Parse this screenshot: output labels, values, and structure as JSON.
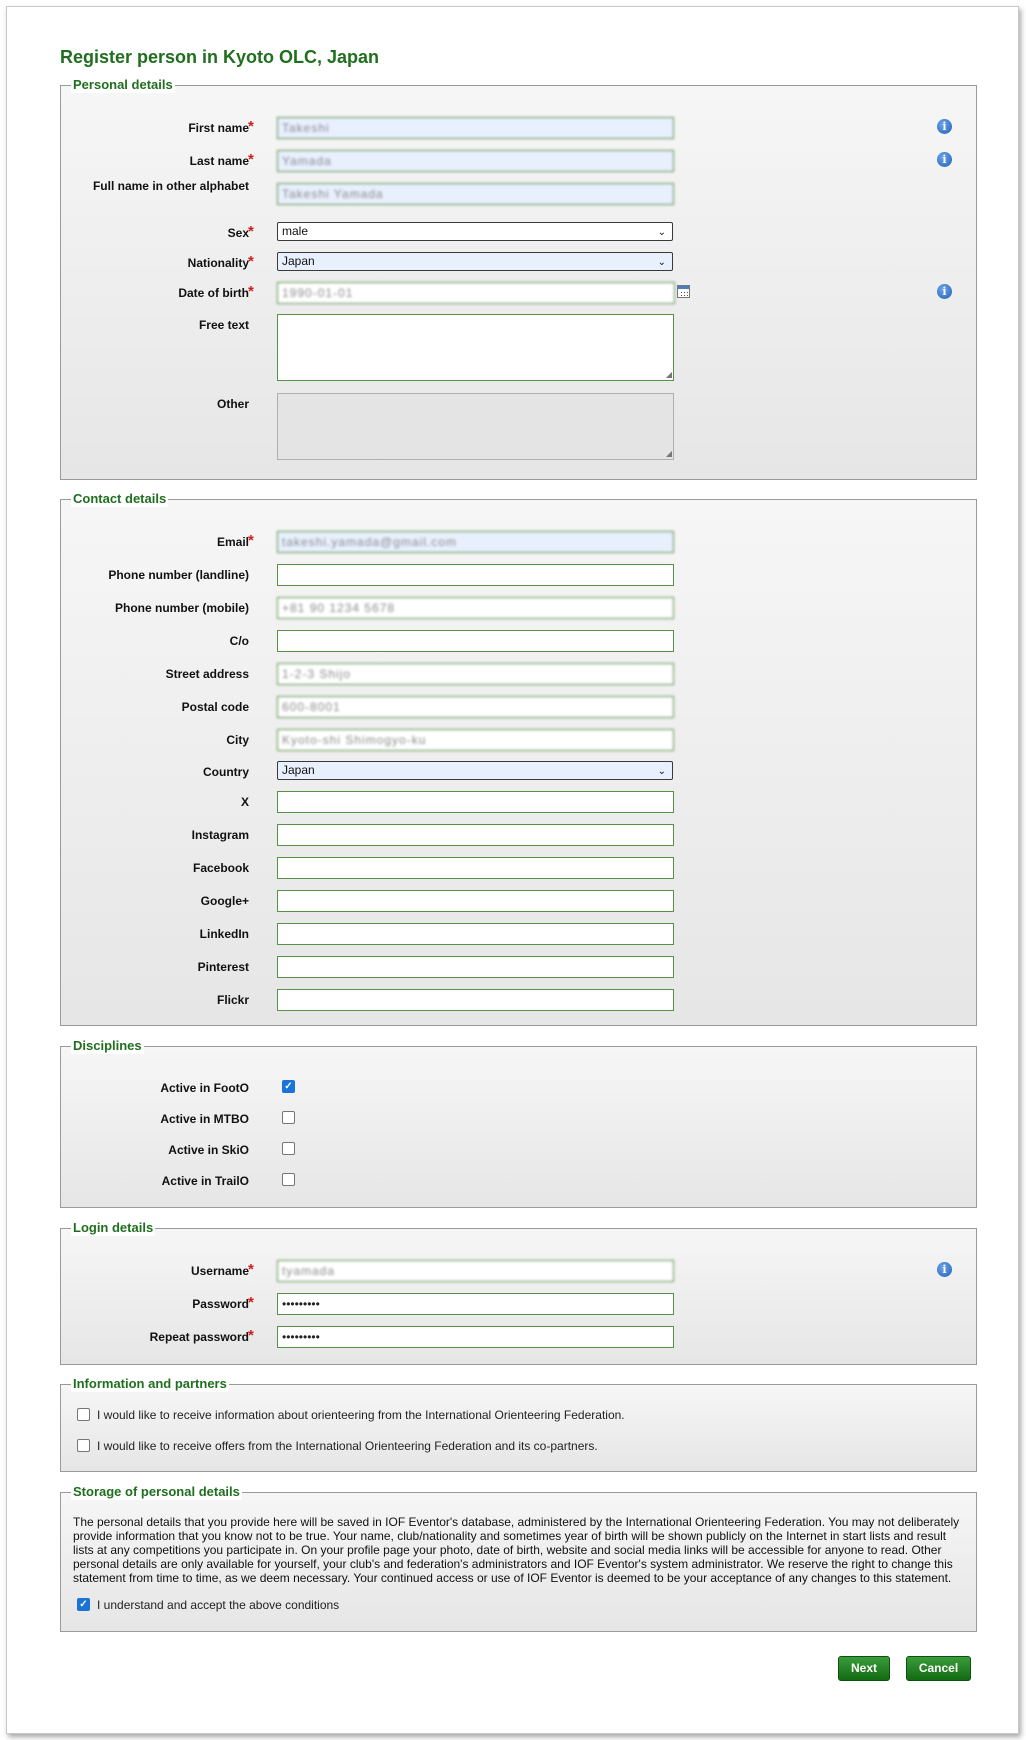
{
  "page_title": "Register person in Kyoto OLC, Japan",
  "personal": {
    "legend": "Personal details",
    "first_name_label": "First name",
    "first_name_value": "Takeshi",
    "last_name_label": "Last name",
    "last_name_value": "Yamada",
    "full_name_label": "Full name in other alphabet",
    "full_name_value": "Takeshi Yamada",
    "sex_label": "Sex",
    "sex_value": "male",
    "nationality_label": "Nationality",
    "nationality_value": "Japan",
    "dob_label": "Date of birth",
    "dob_value": "1990-01-01",
    "free_text_label": "Free text",
    "other_label": "Other"
  },
  "contact": {
    "legend": "Contact details",
    "email_label": "Email",
    "email_value": "takeshi.yamada@gmail.com",
    "phone_landline_label": "Phone number (landline)",
    "phone_mobile_label": "Phone number (mobile)",
    "phone_mobile_value": "+81 90 1234 5678",
    "co_label": "C/o",
    "street_label": "Street address",
    "street_value": "1-2-3 Shijo",
    "postal_label": "Postal code",
    "postal_value": "600-8001",
    "city_label": "City",
    "city_value": "Kyoto-shi Shimogyo-ku",
    "country_label": "Country",
    "country_value": "Japan",
    "x_label": "X",
    "instagram_label": "Instagram",
    "facebook_label": "Facebook",
    "googleplus_label": "Google+",
    "linkedin_label": "LinkedIn",
    "pinterest_label": "Pinterest",
    "flickr_label": "Flickr"
  },
  "disciplines": {
    "legend": "Disciplines",
    "foot_label": "Active in FootO",
    "mtb_label": "Active in MTBO",
    "ski_label": "Active in SkiO",
    "trail_label": "Active in TrailO",
    "check_mark": "✓"
  },
  "login": {
    "legend": "Login details",
    "username_label": "Username",
    "username_value": "tyamada",
    "password_label": "Password",
    "password_value": "•••••••••",
    "repeat_label": "Repeat password",
    "repeat_value": "•••••••••"
  },
  "info": {
    "legend": "Information and partners",
    "opt1": "I would like to receive information about orienteering from the International Orienteering Federation.",
    "opt2": "I would like to receive offers from the International Orienteering Federation and its co-partners."
  },
  "storage": {
    "legend": "Storage of personal details",
    "text": "The personal details that you provide here will be saved in IOF Eventor's database, administered by the International Orienteering Federation. You may not deliberately provide information that you know not to be true. Your name, club/nationality and sometimes year of birth will be shown publicly on the Internet in start lists and result lists at any competitions you participate in. On your profile page your photo, date of birth, website and social media links will be accessible for anyone to read. Other personal details are only available for yourself, your club's and federation's administrators and IOF Eventor's system administrator. We reserve the right to change this statement from time to time, as we deem necessary. Your continued access or use of IOF Eventor is deemed to be your acceptance of any changes to this statement.",
    "accept_label": "I understand and accept the above conditions"
  },
  "buttons": {
    "next": "Next",
    "cancel": "Cancel"
  },
  "symbols": {
    "required": "*",
    "info": "i",
    "chevron": "⌄",
    "resize": "◢"
  }
}
